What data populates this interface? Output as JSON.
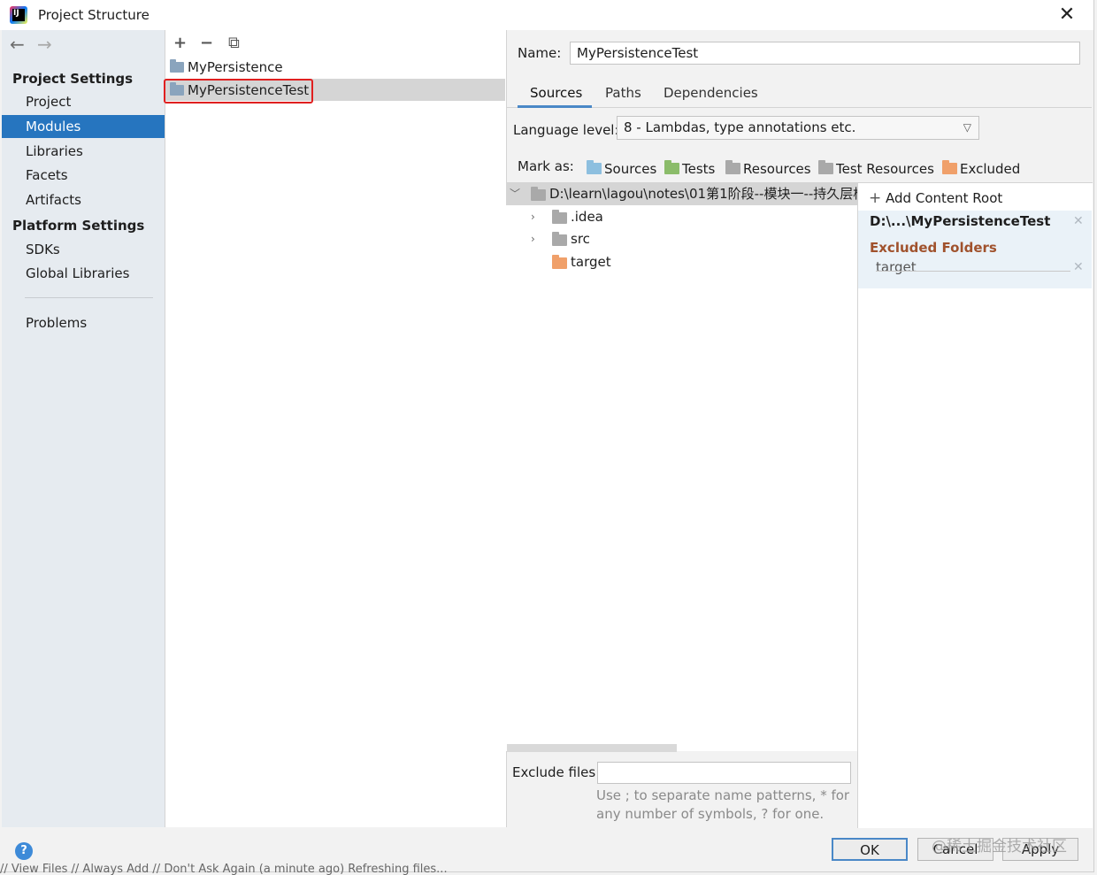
{
  "window": {
    "title": "Project Structure",
    "close_glyph": "✕"
  },
  "nav": {
    "back_glyph": "←",
    "forward_glyph": "→",
    "project_settings_title": "Project Settings",
    "project_settings_items": [
      "Project",
      "Modules",
      "Libraries",
      "Facets",
      "Artifacts"
    ],
    "platform_settings_title": "Platform Settings",
    "platform_settings_items": [
      "SDKs",
      "Global Libraries"
    ],
    "problems_label": "Problems",
    "selected": "Modules"
  },
  "modules": {
    "toolbar": {
      "add_glyph": "+",
      "remove_glyph": "−",
      "copy_glyph": "⧉"
    },
    "items": [
      "MyPersistence",
      "MyPersistenceTest"
    ],
    "selected": "MyPersistenceTest"
  },
  "detail": {
    "name_label": "Name:",
    "name_value": "MyPersistenceTest",
    "tabs": [
      "Sources",
      "Paths",
      "Dependencies"
    ],
    "active_tab": "Sources",
    "language_level_label": "Language level:",
    "language_level_value": "8 - Lambdas, type annotations etc.",
    "mark_as_label": "Mark as:",
    "mark_as": [
      "Sources",
      "Tests",
      "Resources",
      "Test Resources",
      "Excluded"
    ],
    "tree": {
      "root": "D:\\learn\\lagou\\notes\\01第1阶段--模块一--持久层框",
      "children": [
        ".idea",
        "src",
        "target"
      ]
    },
    "exclude_files_label": "Exclude files:",
    "exclude_files_value": "",
    "hint_line1": "Use ; to separate name patterns, * for",
    "hint_line2": "any number of symbols, ? for one."
  },
  "content_root": {
    "add_label": "Add Content Root",
    "path": "D:\\...\\MyPersistenceTest",
    "excluded_title": "Excluded Folders",
    "excluded_items": [
      "target"
    ]
  },
  "buttons": {
    "ok": "OK",
    "cancel": "Cancel",
    "apply": "Apply",
    "help": "?"
  },
  "watermark": "@稀土掘金技术社区",
  "statusbar": "// View Files // Always Add // Don't Ask Again (a minute ago)     Refreshing files...",
  "colors": {
    "selection": "#2675bf",
    "highlight_box": "#e02020",
    "excluded_title": "#a0522d"
  }
}
